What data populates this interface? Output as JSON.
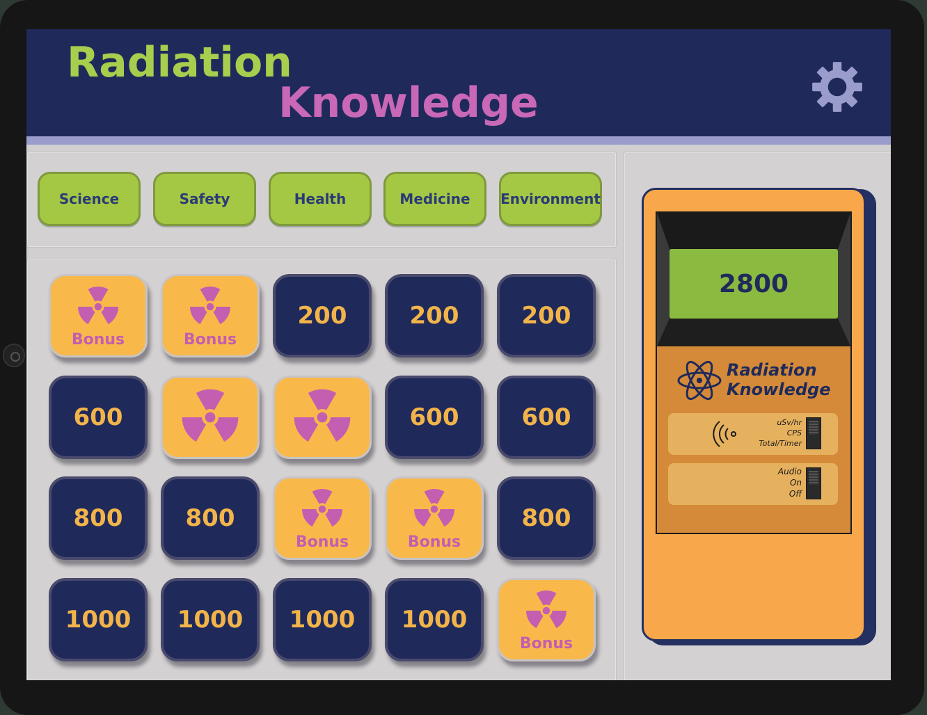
{
  "header": {
    "title_line1": "Radiation",
    "title_line2": "Knowledge",
    "settings_icon": "gear-icon"
  },
  "categories": [
    "Science",
    "Safety",
    "Health",
    "Medicine",
    "Environment"
  ],
  "board": {
    "rows": [
      [
        {
          "type": "bonus",
          "label": "Bonus"
        },
        {
          "type": "bonus",
          "label": "Bonus"
        },
        {
          "type": "points",
          "label": "200"
        },
        {
          "type": "points",
          "label": "200"
        },
        {
          "type": "points",
          "label": "200"
        }
      ],
      [
        {
          "type": "points",
          "label": "600"
        },
        {
          "type": "icon",
          "label": ""
        },
        {
          "type": "icon",
          "label": ""
        },
        {
          "type": "points",
          "label": "600"
        },
        {
          "type": "points",
          "label": "600"
        }
      ],
      [
        {
          "type": "points",
          "label": "800"
        },
        {
          "type": "points",
          "label": "800"
        },
        {
          "type": "bonus",
          "label": "Bonus"
        },
        {
          "type": "bonus",
          "label": "Bonus"
        },
        {
          "type": "points",
          "label": "800"
        }
      ],
      [
        {
          "type": "points",
          "label": "1000"
        },
        {
          "type": "points",
          "label": "1000"
        },
        {
          "type": "points",
          "label": "1000"
        },
        {
          "type": "points",
          "label": "1000"
        },
        {
          "type": "bonus",
          "label": "Bonus"
        }
      ]
    ]
  },
  "meter": {
    "score": "2800",
    "brand_line1": "Radiation",
    "brand_line2": "Knowledge",
    "mode_labels": [
      "uSv/hr",
      "CPS",
      "Total/Timer"
    ],
    "audio_labels": [
      "Audio",
      "On",
      "Off"
    ]
  },
  "colors": {
    "header_bg": "#1f2a5b",
    "title_green": "#a9ce4e",
    "title_pink": "#c968b7",
    "tile_navy": "#1f2a5b",
    "tile_bonus": "#f8b94a",
    "category_green": "#a4c843",
    "meter_orange": "#f8a84a"
  }
}
